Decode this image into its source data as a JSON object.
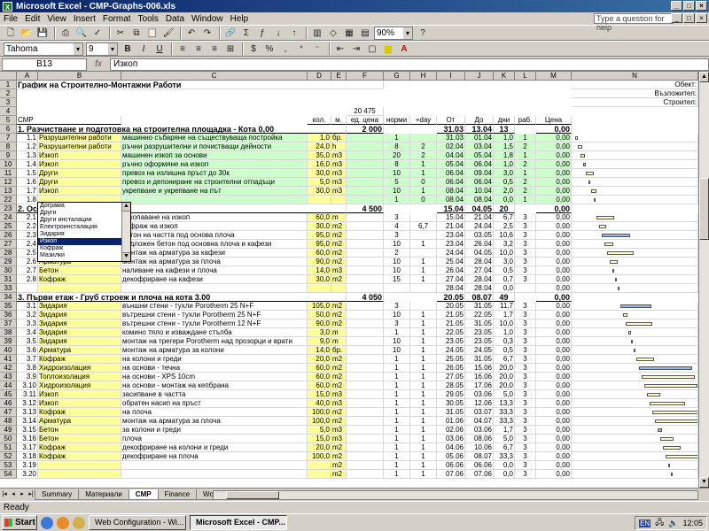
{
  "window": {
    "title": "Microsoft Excel - CMP-Graphs-006.xls",
    "minimize": "_",
    "maximize": "□",
    "close": "×"
  },
  "menu": [
    "File",
    "Edit",
    "View",
    "Insert",
    "Format",
    "Tools",
    "Data",
    "Window",
    "Help"
  ],
  "help_placeholder": "Type a question for help",
  "toolbar": {
    "font": "Tahoma",
    "size": "9",
    "zoom": "90%"
  },
  "formula": {
    "cell": "B13",
    "fx": "fx",
    "value": "Изкоп"
  },
  "columns": [
    "A",
    "B",
    "C",
    "D",
    "E",
    "F",
    "G",
    "H",
    "I",
    "J",
    "K",
    "L",
    "M",
    "N"
  ],
  "sheet": {
    "title": "График на Строително-Монтажни Работи",
    "labels": {
      "object": "Обект:",
      "client": "Възложител:",
      "builder": "Строител:"
    },
    "total": "20 475",
    "header": {
      "a": "СМР",
      "qty": "кол.",
      "unit": "м.",
      "price": "ед. цена",
      "norm": "норми",
      "day": "+day",
      "from": "От",
      "to": "До",
      "days": "дни",
      "workers": "раб.",
      "cost": "Цена"
    }
  },
  "sections": [
    {
      "row": "6",
      "title": "1. Разчистване и подготовка на строителна площадка - Кота 0,00",
      "price": "2 000",
      "from": "31.03",
      "to": "13.04",
      "days": "13",
      "cost": "0,00"
    },
    {
      "row": "23",
      "title": "2. Основи",
      "price": "4 500",
      "from": "15.04",
      "to": "04.05",
      "days": "20",
      "cost": "0,00"
    },
    {
      "row": "34",
      "title": "3. Първи етаж - Груб строеж и плоча на кота 3.00",
      "price": "4 050",
      "from": "20.05",
      "to": "08.07",
      "days": "49",
      "cost": "0,00"
    }
  ],
  "rows": [
    {
      "r": "7",
      "n": "1.1",
      "t": "Разрушителни работи",
      "d": "машинно събаряне на съществуваща постройка",
      "q": "1,0",
      "u": "бр.",
      "g": "1",
      "h": "",
      "f": "31.03",
      "to": "01.04",
      "k": "1,0",
      "l": "1",
      "m": "0,00",
      "c": "g"
    },
    {
      "r": "8",
      "n": "1.2",
      "t": "Разрушителни работи",
      "d": "ръчни разрушителни и почистващи дейности",
      "q": "24,0",
      "u": "h",
      "g": "8",
      "h": "2",
      "f": "02.04",
      "to": "03.04",
      "k": "1,5",
      "l": "2",
      "m": "0,00",
      "c": "g"
    },
    {
      "r": "9",
      "n": "1.3",
      "t": "Изкоп",
      "d": "машинен изкоп за основи",
      "q": "35,0",
      "u": "m3",
      "g": "20",
      "h": "2",
      "f": "04.04",
      "to": "05.04",
      "k": "1,8",
      "l": "1",
      "m": "0,00",
      "c": "g"
    },
    {
      "r": "10",
      "n": "1.4",
      "t": "Изкоп",
      "d": "ръчно оформяне на изкоп",
      "q": "16,0",
      "u": "m3",
      "g": "8",
      "h": "1",
      "f": "05.04",
      "to": "06.04",
      "k": "1,0",
      "l": "2",
      "m": "0,00",
      "c": "g"
    },
    {
      "r": "11",
      "n": "1.5",
      "t": "Други",
      "d": "превоз на излишна пръст до 30к",
      "q": "30,0",
      "u": "m3",
      "g": "10",
      "h": "1",
      "f": "06.04",
      "to": "09.04",
      "k": "3,0",
      "l": "1",
      "m": "0,00",
      "c": "g"
    },
    {
      "r": "12",
      "n": "1.6",
      "t": "Други",
      "d": "превоз и депониране на строителни отпадъци",
      "q": "5,0",
      "u": "m3",
      "g": "5",
      "h": "0",
      "f": "06.04",
      "to": "06.04",
      "k": "0,5",
      "l": "2",
      "m": "0,00",
      "c": "g"
    },
    {
      "r": "13",
      "n": "1.7",
      "t": "Изкоп",
      "d": "укрепване и укрепване на път",
      "q": "30,0",
      "u": "m3",
      "g": "10",
      "h": "1",
      "f": "08.04",
      "to": "10.04",
      "k": "2,0",
      "l": "2",
      "m": "0,00",
      "c": "g"
    },
    {
      "r": "22",
      "n": "1.8",
      "t": "",
      "d": "",
      "q": "",
      "u": "",
      "g": "1",
      "h": "0",
      "f": "08.04",
      "to": "08.04",
      "k": "0,0",
      "l": "1",
      "m": "0,00",
      "c": "g"
    },
    {
      "r": "24",
      "n": "2.1",
      "t": "",
      "d": "изкопаване на изкоп",
      "q": "60,0",
      "u": "m",
      "g": "3",
      "h": "",
      "f": "15.04",
      "to": "21.04",
      "k": "6,7",
      "l": "3",
      "m": "0,00",
      "c": "w"
    },
    {
      "r": "25",
      "n": "2.2",
      "t": "",
      "d": "кофраж на изкоп",
      "q": "30,0",
      "u": "m2",
      "g": "4",
      "h": "6,7",
      "f": "21.04",
      "to": "24.04",
      "k": "2,5",
      "l": "3",
      "m": "0,00",
      "c": "w"
    },
    {
      "r": "26",
      "n": "2.3",
      "t": "",
      "d": "бетон на частта под основа плоча",
      "q": "95,0",
      "u": "m2",
      "g": "3",
      "h": "",
      "f": "23.04",
      "to": "03.05",
      "k": "10,6",
      "l": "3",
      "m": "0,00",
      "c": "w"
    },
    {
      "r": "27",
      "n": "2.4",
      "t": "",
      "d": "подложен бетон под основна плоча и кафези",
      "q": "95,0",
      "u": "m2",
      "g": "10",
      "h": "1",
      "f": "23.04",
      "to": "26.04",
      "k": "3,2",
      "l": "3",
      "m": "0,00",
      "c": "w"
    },
    {
      "r": "28",
      "n": "2.5",
      "t": "Мазилки",
      "d": "монтаж на арматура за кафези",
      "q": "60,0",
      "u": "m2",
      "g": "2",
      "h": "",
      "f": "24.04",
      "to": "04.05",
      "k": "10,0",
      "l": "3",
      "m": "0,00",
      "c": "w"
    },
    {
      "r": "29",
      "n": "2.6",
      "t": "Арматура",
      "d": "монтаж на арматура за плоча",
      "q": "90,0",
      "u": "m2",
      "g": "10",
      "h": "1",
      "f": "25.04",
      "to": "28.04",
      "k": "3,0",
      "l": "3",
      "m": "0,00",
      "c": "w"
    },
    {
      "r": "30",
      "n": "2.7",
      "t": "Бетон",
      "d": "наливане на кафези и плоча",
      "q": "14,0",
      "u": "m3",
      "g": "10",
      "h": "1",
      "f": "26.04",
      "to": "27.04",
      "k": "0,5",
      "l": "3",
      "m": "0,00",
      "c": "w"
    },
    {
      "r": "31",
      "n": "2.8",
      "t": "Кофраж",
      "d": "декофриране на кафези",
      "q": "30,0",
      "u": "m2",
      "g": "15",
      "h": "1",
      "f": "27.04",
      "to": "28.04",
      "k": "0,7",
      "l": "3",
      "m": "0,00",
      "c": "w"
    },
    {
      "r": "33",
      "n": "",
      "t": "",
      "d": "",
      "q": "",
      "u": "",
      "g": "",
      "h": "",
      "f": "28.04",
      "to": "28.04",
      "k": "0,0",
      "l": "",
      "m": "0,00",
      "c": "w"
    },
    {
      "r": "35",
      "n": "3.1",
      "t": "Зидария",
      "d": "външни стени - тухли Porotherm 25 N+F",
      "q": "105,0",
      "u": "m2",
      "g": "3",
      "h": "",
      "f": "20.05",
      "to": "31.05",
      "k": "11,7",
      "l": "3",
      "m": "0,00",
      "c": "w"
    },
    {
      "r": "36",
      "n": "3.2",
      "t": "Зидария",
      "d": "вътрешни стени - тухли Porotherm 25 N+F",
      "q": "50,0",
      "u": "m2",
      "g": "10",
      "h": "1",
      "f": "21.05",
      "to": "22.05",
      "k": "1,7",
      "l": "3",
      "m": "0,00",
      "c": "w"
    },
    {
      "r": "37",
      "n": "3.3",
      "t": "Зидария",
      "d": "вътрешни стени - тухли Porotherm 12 N+F",
      "q": "90,0",
      "u": "m2",
      "g": "3",
      "h": "1",
      "f": "21.05",
      "to": "31.05",
      "k": "10,0",
      "l": "3",
      "m": "0,00",
      "c": "w"
    },
    {
      "r": "38",
      "n": "3.4",
      "t": "Зидария",
      "d": "комино тяло и изваждане стълба",
      "q": "3,0",
      "u": "m",
      "g": "1",
      "h": "1",
      "f": "22.05",
      "to": "23.05",
      "k": "1,0",
      "l": "3",
      "m": "0,00",
      "c": "w"
    },
    {
      "r": "39",
      "n": "3.5",
      "t": "Зидария",
      "d": "монтаж на трегери Porotherm над прозорци и врати",
      "q": "9,0",
      "u": "m",
      "g": "10",
      "h": "1",
      "f": "23.05",
      "to": "23.05",
      "k": "0,3",
      "l": "3",
      "m": "0,00",
      "c": "w"
    },
    {
      "r": "40",
      "n": "3.6",
      "t": "Арматура",
      "d": "монтаж на арматура за колони",
      "q": "14,0",
      "u": "бр.",
      "g": "10",
      "h": "1",
      "f": "24.05",
      "to": "24.05",
      "k": "0,5",
      "l": "3",
      "m": "0,00",
      "c": "w"
    },
    {
      "r": "41",
      "n": "3.7",
      "t": "Кофраж",
      "d": "на колони и греди",
      "q": "20,0",
      "u": "m2",
      "g": "1",
      "h": "1",
      "f": "25.05",
      "to": "31.05",
      "k": "6,7",
      "l": "3",
      "m": "0,00",
      "c": "w"
    },
    {
      "r": "42",
      "n": "3.8",
      "t": "Хидроизолация",
      "d": "на основи - течна",
      "q": "60,0",
      "u": "m2",
      "g": "1",
      "h": "1",
      "f": "26.05",
      "to": "15.06",
      "k": "20,0",
      "l": "3",
      "m": "0,00",
      "c": "w"
    },
    {
      "r": "43",
      "n": "3.9",
      "t": "Топлоизолация",
      "d": "на основи - XPS 10cm",
      "q": "60,0",
      "u": "m2",
      "g": "1",
      "h": "1",
      "f": "27.05",
      "to": "16.06",
      "k": "20,0",
      "l": "3",
      "m": "0,00",
      "c": "w"
    },
    {
      "r": "44",
      "n": "3.10",
      "t": "Хидроизолация",
      "d": "на основи - монтаж на кепбрана",
      "q": "60,0",
      "u": "m2",
      "g": "1",
      "h": "1",
      "f": "28.05",
      "to": "17.06",
      "k": "20,0",
      "l": "3",
      "m": "0,00",
      "c": "w"
    },
    {
      "r": "45",
      "n": "3.11",
      "t": "Изкоп",
      "d": "засипване в частта",
      "q": "15,0",
      "u": "m3",
      "g": "1",
      "h": "1",
      "f": "29.05",
      "to": "03.06",
      "k": "5,0",
      "l": "3",
      "m": "0,00",
      "c": "w"
    },
    {
      "r": "46",
      "n": "3.12",
      "t": "Изкоп",
      "d": "обратен насип на пръст",
      "q": "40,0",
      "u": "m3",
      "g": "1",
      "h": "1",
      "f": "30.05",
      "to": "12.06",
      "k": "13,3",
      "l": "3",
      "m": "0,00",
      "c": "w"
    },
    {
      "r": "47",
      "n": "3.13",
      "t": "Кофраж",
      "d": "на плоча",
      "q": "100,0",
      "u": "m2",
      "g": "1",
      "h": "1",
      "f": "31.05",
      "to": "03.07",
      "k": "33,3",
      "l": "3",
      "m": "0,00",
      "c": "w"
    },
    {
      "r": "48",
      "n": "3.14",
      "t": "Арматура",
      "d": "монтаж на арматура за плоча",
      "q": "100,0",
      "u": "m2",
      "g": "1",
      "h": "1",
      "f": "01.06",
      "to": "04.07",
      "k": "33,3",
      "l": "3",
      "m": "0,00",
      "c": "w"
    },
    {
      "r": "49",
      "n": "3.15",
      "t": "Бетон",
      "d": "за колони и греди",
      "q": "5,0",
      "u": "m3",
      "g": "1",
      "h": "1",
      "f": "02.06",
      "to": "03.06",
      "k": "1,7",
      "l": "3",
      "m": "0,00",
      "c": "w"
    },
    {
      "r": "50",
      "n": "3.16",
      "t": "Бетон",
      "d": "плоча",
      "q": "15,0",
      "u": "m3",
      "g": "1",
      "h": "1",
      "f": "03.06",
      "to": "08.06",
      "k": "5,0",
      "l": "3",
      "m": "0,00",
      "c": "w"
    },
    {
      "r": "51",
      "n": "3.17",
      "t": "Кофраж",
      "d": "декофриране на колони и греди",
      "q": "20,0",
      "u": "m2",
      "g": "1",
      "h": "1",
      "f": "04.06",
      "to": "10.06",
      "k": "6,7",
      "l": "3",
      "m": "0,00",
      "c": "w"
    },
    {
      "r": "52",
      "n": "3.18",
      "t": "Кофраж",
      "d": "декофриране на плоча",
      "q": "100,0",
      "u": "m2",
      "g": "1",
      "h": "1",
      "f": "05.06",
      "to": "08.07",
      "k": "33,3",
      "l": "3",
      "m": "0,00",
      "c": "w"
    },
    {
      "r": "53",
      "n": "3.19",
      "t": "",
      "d": "",
      "q": "",
      "u": "m2",
      "g": "1",
      "h": "1",
      "f": "06.06",
      "to": "06.06",
      "k": "0,0",
      "l": "3",
      "m": "0,00",
      "c": "w"
    },
    {
      "r": "54",
      "n": "3.20",
      "t": "",
      "d": "",
      "q": "",
      "u": "m2",
      "g": "1",
      "h": "1",
      "f": "07.06",
      "to": "07.06",
      "k": "0,0",
      "l": "3",
      "m": "0,00",
      "c": "w"
    }
  ],
  "dropdown": {
    "items": [
      "Дограма",
      "Други",
      "Други инсталации",
      "Електроинсталация",
      "Зидария",
      "Изкоп",
      "Кофраж",
      "Мазилки"
    ],
    "selected": 5
  },
  "tabs": [
    "Summary",
    "Материали",
    "CMP",
    "Finance",
    "Workers"
  ],
  "active_tab": "CMP",
  "status": "Ready",
  "taskbar": {
    "start": "Start",
    "tasks": [
      "Web Configuration - Wi...",
      "Microsoft Excel - CMP..."
    ],
    "lang": "EN",
    "clock": "12:05"
  },
  "colors": {
    "yellow": "#ffff99",
    "green": "#ccffcc",
    "title_dark": "#0a246a",
    "gantt_blue": "#9ab8e6"
  }
}
